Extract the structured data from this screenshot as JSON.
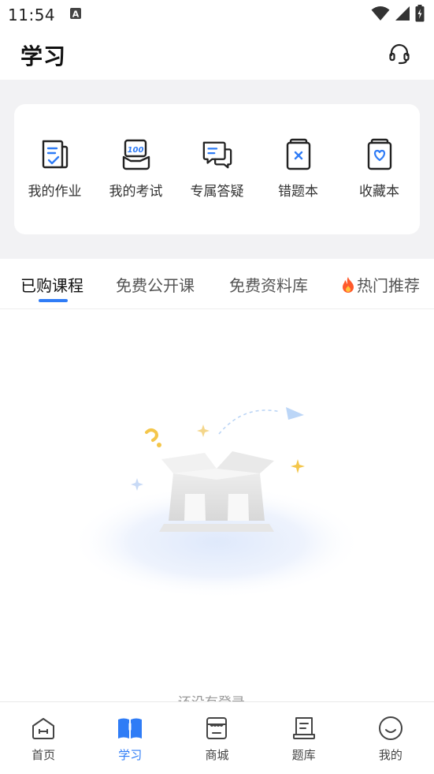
{
  "status": {
    "time": "11:54",
    "notification_icon": "font-a-icon",
    "wifi_icon": "wifi-icon",
    "signal_icon": "signal-icon",
    "battery_icon": "battery-icon"
  },
  "header": {
    "title": "学习",
    "support_icon": "headset-icon"
  },
  "quick_actions": [
    {
      "label": "我的作业",
      "icon": "homework-icon"
    },
    {
      "label": "我的考试",
      "icon": "exam-icon"
    },
    {
      "label": "专属答疑",
      "icon": "qa-chat-icon"
    },
    {
      "label": "错题本",
      "icon": "wrong-book-icon"
    },
    {
      "label": "收藏本",
      "icon": "favorites-book-icon"
    }
  ],
  "tabs": [
    {
      "label": "已购课程",
      "active": true
    },
    {
      "label": "免费公开课",
      "active": false
    },
    {
      "label": "免费资料库",
      "active": false
    },
    {
      "label": "热门推荐",
      "active": false,
      "icon": "fire-icon"
    }
  ],
  "empty_state": {
    "text": "还没有登录~",
    "illustration": "empty-box-illustration"
  },
  "bottom_nav": [
    {
      "label": "首页",
      "icon": "home-icon",
      "active": false
    },
    {
      "label": "学习",
      "icon": "study-book-icon",
      "active": true
    },
    {
      "label": "商城",
      "icon": "shop-icon",
      "active": false
    },
    {
      "label": "题库",
      "icon": "question-bank-icon",
      "active": false
    },
    {
      "label": "我的",
      "icon": "profile-smile-icon",
      "active": false
    }
  ],
  "colors": {
    "accent": "#2f7cf6",
    "band": "#f2f2f4",
    "text": "#222222",
    "muted": "#999999",
    "fire": "#ff5a2c"
  }
}
